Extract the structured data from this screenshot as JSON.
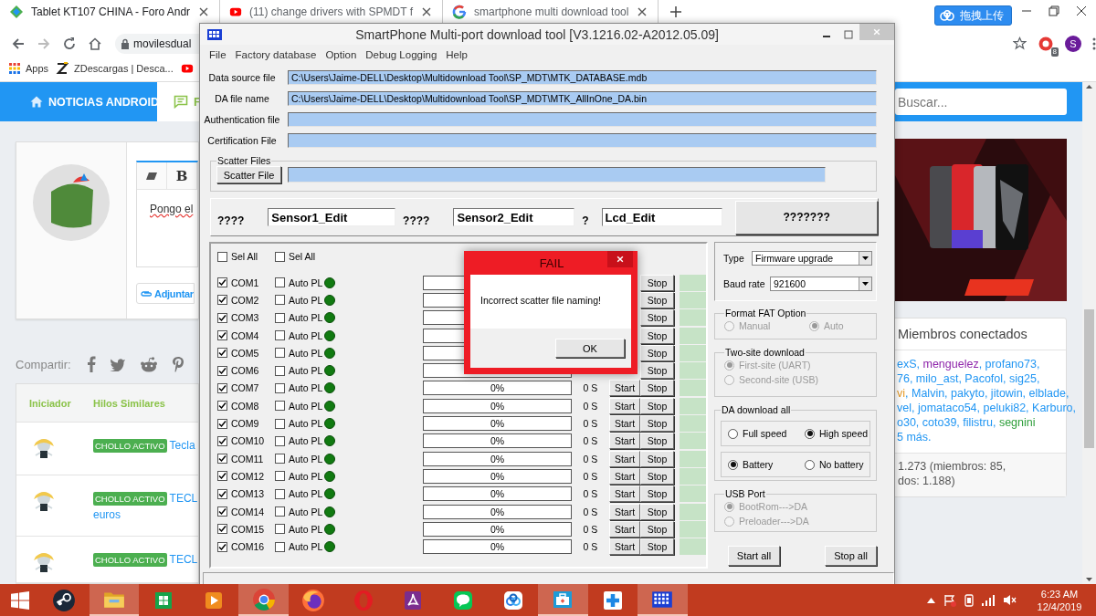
{
  "browser": {
    "tabs": [
      {
        "title": "Tablet KT107 CHINA - Foro Andr",
        "kind": "site",
        "selected": true
      },
      {
        "title": "(11) change drivers with SPMDT f",
        "kind": "video",
        "selected": false
      },
      {
        "title": "smartphone multi download tool",
        "kind": "search",
        "selected": false
      }
    ],
    "upload_button": "拖拽上传",
    "address": "movilesdual",
    "extension_badge": "8",
    "profile": "S",
    "bookmarks": [
      {
        "kind": "apps",
        "label": "Apps"
      },
      {
        "kind": "z",
        "label": "ZDescargas | Desca..."
      },
      {
        "kind": "video"
      }
    ]
  },
  "page": {
    "nav": {
      "home": "NOTICIAS ANDROID",
      "forum": "F"
    },
    "search": {
      "placeholder": "Buscar..."
    },
    "editor": {
      "bold": "B",
      "text": "Pongo el",
      "attach": "Adjuntar"
    },
    "share": {
      "label": "Compartir:"
    },
    "threads": {
      "columns": [
        "Iniciador",
        "Hilos Similares"
      ],
      "rows": [
        {
          "badge": "CHOLLO ACTIVO",
          "title": [
            "Tecla"
          ]
        },
        {
          "badge": "CHOLLO ACTIVO",
          "title": [
            "TECL",
            "euros"
          ]
        },
        {
          "badge": "CHOLLO ACTIVO",
          "title": [
            "TECL"
          ]
        }
      ]
    },
    "members": {
      "title": "Miembros conectados",
      "lines": [
        [
          {
            "text": "exS",
            "color": "#2196f3",
            "after": ", "
          },
          {
            "text": "menguelez",
            "color": "#8e24aa",
            "after": ", "
          },
          {
            "text": "profano73",
            "color": "#2196f3",
            "after": ","
          }
        ],
        [
          {
            "text": "76",
            "color": "#2196f3",
            "after": ", "
          },
          {
            "text": "milo_ast",
            "color": "#2196f3",
            "after": ", "
          },
          {
            "text": "Pacofol",
            "color": "#2196f3",
            "after": ", "
          },
          {
            "text": "sig25",
            "color": "#2196f3",
            "after": ","
          }
        ],
        [
          {
            "text": "vi",
            "color": "#e69a28",
            "after": ", "
          },
          {
            "text": "Malvin",
            "color": "#2196f3",
            "after": ", "
          },
          {
            "text": "pakyto",
            "color": "#2196f3",
            "after": ", "
          },
          {
            "text": "jitowin",
            "color": "#2196f3",
            "after": ", "
          },
          {
            "text": "elblade",
            "color": "#2196f3",
            "after": ","
          }
        ],
        [
          {
            "text": "vel",
            "color": "#2196f3",
            "after": ", "
          },
          {
            "text": "jomataco54",
            "color": "#2196f3",
            "after": ", "
          },
          {
            "text": "peluki82",
            "color": "#2196f3",
            "after": ", "
          },
          {
            "text": "Karburo",
            "color": "#2196f3",
            "after": ","
          }
        ],
        [
          {
            "text": "o30",
            "color": "#2196f3",
            "after": ", "
          },
          {
            "text": "coto39",
            "color": "#2196f3",
            "after": ", "
          },
          {
            "text": "filistru",
            "color": "#2196f3",
            "after": ", "
          },
          {
            "text": "segnini",
            "color": "#2e9e3a"
          }
        ]
      ],
      "more": "5 más.",
      "totals": [
        "1.273 (miembros: 85,",
        "dos: 1.188)"
      ]
    }
  },
  "app": {
    "title": "SmartPhone Multi-port download tool [V3.1216.02-A2012.05.09]",
    "menu": [
      "File",
      "Factory database",
      "Option",
      "Debug Logging",
      "Help"
    ],
    "files": [
      {
        "label": "Data source file",
        "value": "C:\\Users\\Jaime-DELL\\Desktop\\Multidownload Tool\\SP_MDT\\MTK_DATABASE.mdb"
      },
      {
        "label": "DA file name",
        "value": "C:\\Users\\Jaime-DELL\\Desktop\\Multidownload Tool\\SP_MDT\\MTK_AllInOne_DA.bin"
      },
      {
        "label": "Authentication file"
      },
      {
        "label": "Certification File"
      }
    ],
    "scatter": {
      "group": "Scatter Files",
      "button": "Scatter File"
    },
    "sensors": [
      {
        "label": "????",
        "value": "Sensor1_Edit"
      },
      {
        "label": "????",
        "value": "Sensor2_Edit"
      },
      {
        "label": "?",
        "value": "Lcd_Edit"
      }
    ],
    "sensor_button": "???????",
    "select_all": [
      {
        "label": "Sel All",
        "checked": false
      },
      {
        "label": "Sel All",
        "checked": false
      }
    ],
    "ports": [
      {
        "name": "COM1",
        "checked": true,
        "auto": "Auto PL",
        "auto_checked": false,
        "level": 0,
        "stop": "Stop"
      },
      {
        "name": "COM2",
        "checked": true,
        "auto": "Auto PL",
        "auto_checked": false,
        "level": 0,
        "stop": "Stop"
      },
      {
        "name": "COM3",
        "checked": true,
        "auto": "Auto PL",
        "auto_checked": false,
        "level": 0,
        "stop": "Stop"
      },
      {
        "name": "COM4",
        "checked": true,
        "auto": "Auto PL",
        "auto_checked": false,
        "level": 0,
        "stop": "Stop"
      },
      {
        "name": "COM5",
        "checked": true,
        "auto": "Auto PL",
        "auto_checked": false,
        "level": 0,
        "stop": "Stop"
      },
      {
        "name": "COM6",
        "checked": true,
        "auto": "Auto PL",
        "auto_checked": false,
        "level": 0,
        "stop": "Stop"
      },
      {
        "name": "COM7",
        "checked": true,
        "auto": "Auto PL",
        "auto_checked": false,
        "level": 0,
        "percent": "0%",
        "time": "0 S",
        "start": "Start",
        "stop": "Stop"
      },
      {
        "name": "COM8",
        "checked": true,
        "auto": "Auto PL",
        "auto_checked": false,
        "level": 0,
        "percent": "0%",
        "time": "0 S",
        "start": "Start",
        "stop": "Stop"
      },
      {
        "name": "COM9",
        "checked": true,
        "auto": "Auto PL",
        "auto_checked": false,
        "level": 0,
        "percent": "0%",
        "time": "0 S",
        "start": "Start",
        "stop": "Stop"
      },
      {
        "name": "COM10",
        "checked": true,
        "auto": "Auto PL",
        "auto_checked": false,
        "level": 0,
        "percent": "0%",
        "time": "0 S",
        "start": "Start",
        "stop": "Stop"
      },
      {
        "name": "COM11",
        "checked": true,
        "auto": "Auto PL",
        "auto_checked": false,
        "level": 0,
        "percent": "0%",
        "time": "0 S",
        "start": "Start",
        "stop": "Stop"
      },
      {
        "name": "COM12",
        "checked": true,
        "auto": "Auto PL",
        "auto_checked": false,
        "level": 0,
        "percent": "0%",
        "time": "0 S",
        "start": "Start",
        "stop": "Stop"
      },
      {
        "name": "COM13",
        "checked": true,
        "auto": "Auto PL",
        "auto_checked": false,
        "level": 0,
        "percent": "0%",
        "time": "0 S",
        "start": "Start",
        "stop": "Stop"
      },
      {
        "name": "COM14",
        "checked": true,
        "auto": "Auto PL",
        "auto_checked": false,
        "level": 0,
        "percent": "0%",
        "time": "0 S",
        "start": "Start",
        "stop": "Stop"
      },
      {
        "name": "COM15",
        "checked": true,
        "auto": "Auto PL",
        "auto_checked": false,
        "level": 0,
        "percent": "0%",
        "time": "0 S",
        "start": "Start",
        "stop": "Stop"
      },
      {
        "name": "COM16",
        "checked": true,
        "auto": "Auto PL",
        "auto_checked": false,
        "level": 0,
        "percent": "0%",
        "time": "0 S",
        "start": "Start",
        "stop": "Stop"
      }
    ],
    "type": {
      "label": "Type",
      "value": "Firmware upgrade"
    },
    "baud": {
      "label": "Baud rate",
      "value": "921600"
    },
    "groups": [
      {
        "title": "Format FAT Option",
        "disabled": true,
        "kind": "plain",
        "rows": [
          [
            {
              "label": "Manual",
              "selected": false
            },
            {
              "label": "Auto",
              "selected": true
            }
          ]
        ]
      },
      {
        "title": "Two-site download",
        "disabled": true,
        "kind": "plain",
        "rows": [
          [
            {
              "label": "First-site (UART)",
              "selected": true
            }
          ],
          [
            {
              "label": "Second-site (USB)",
              "selected": false
            }
          ]
        ]
      },
      {
        "title": "DA download all",
        "disabled": false,
        "kind": "boxed",
        "rows": [
          [
            {
              "label": "Full speed",
              "selected": false
            },
            {
              "label": "High speed",
              "selected": true
            }
          ],
          [
            {
              "label": "Battery",
              "selected": true
            },
            {
              "label": "No battery",
              "selected": false
            }
          ]
        ]
      },
      {
        "title": "USB Port",
        "disabled": true,
        "kind": "plain",
        "rows": [
          [
            {
              "label": "BootRom--->DA",
              "selected": true
            }
          ],
          [
            {
              "label": "Preloader--->DA",
              "selected": false
            }
          ]
        ]
      }
    ],
    "buttons": [
      "Start all",
      "Stop all"
    ],
    "dialog": {
      "title": "FAIL",
      "message": "Incorrect scatter file naming!",
      "button": "OK"
    }
  },
  "taskbar": {
    "apps": [
      {
        "kind": "steam",
        "active": false
      },
      {
        "kind": "explorer",
        "active": true
      },
      {
        "kind": "store",
        "active": false
      },
      {
        "kind": "media",
        "active": false
      },
      {
        "kind": "chrome",
        "active": true
      },
      {
        "kind": "firefox",
        "active": false
      },
      {
        "kind": "opera",
        "active": false
      },
      {
        "kind": "pdf",
        "active": false
      },
      {
        "kind": "chat",
        "active": false
      },
      {
        "kind": "cloud",
        "active": false
      },
      {
        "kind": "toolbox",
        "active": true
      },
      {
        "kind": "plus",
        "active": false
      },
      {
        "kind": "grid",
        "active": true
      }
    ],
    "time": "6:23 AM",
    "date": "12/4/2019"
  }
}
